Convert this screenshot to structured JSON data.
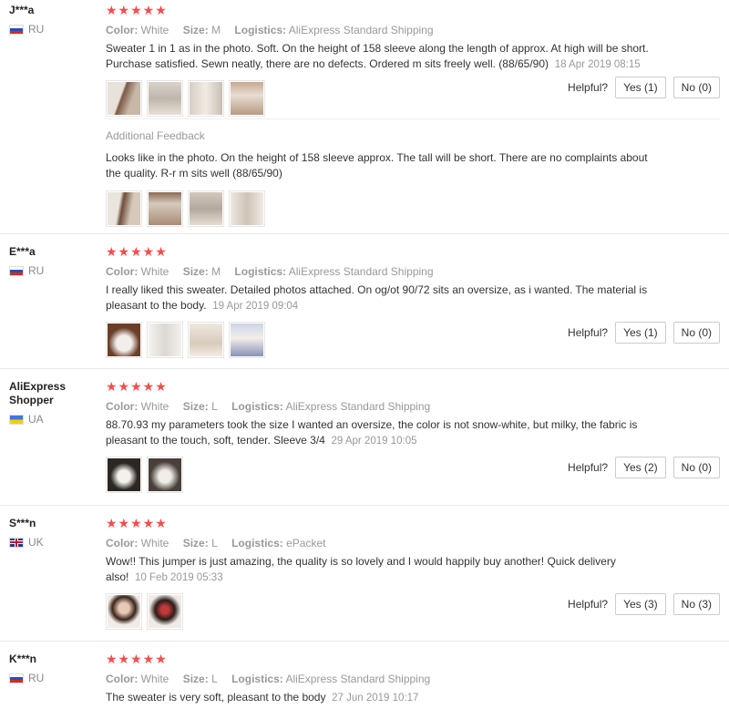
{
  "labels": {
    "color": "Color:",
    "size": "Size:",
    "logistics": "Logistics:",
    "helpful": "Helpful?"
  },
  "stars": "★★★★★",
  "colors": {
    "star": "#f44d4d",
    "meta": "#999999"
  },
  "reviews": [
    {
      "user": "J***a",
      "country": "RU",
      "flag": "ru",
      "color": "White",
      "size": "M",
      "logistics": "AliExpress Standard Shipping",
      "text": "Sweater 1 in 1 as in the photo. Soft. On the height of 158 sleeve along the length of approx. At high will be short. Purchase satisfied. Sewn neatly, there are no defects. Ordered m sits freely well. (88/65/90)",
      "date": "18 Apr 2019 08:15",
      "yes": "Yes (1)",
      "no": "No (0)",
      "additional_title": "Additional Feedback",
      "additional_text": "Looks like in the photo. On the height of 158 sleeve approx. The tall will be short. There are no complaints about the quality. R-r m sits well (88/65/90)"
    },
    {
      "user": "E***a",
      "country": "RU",
      "flag": "ru",
      "color": "White",
      "size": "M",
      "logistics": "AliExpress Standard Shipping",
      "text": "I really liked this sweater. Detailed photos attached. On og/ot 90/72 sits an oversize, as i wanted. The material is pleasant to the body.",
      "date": "19 Apr 2019 09:04",
      "yes": "Yes (1)",
      "no": "No (0)"
    },
    {
      "user": "AliExpress Shopper",
      "country": "UA",
      "flag": "ua",
      "color": "White",
      "size": "L",
      "logistics": "AliExpress Standard Shipping",
      "text": "88.70.93 my parameters took the size I wanted an oversize, the color is not snow-white, but milky, the fabric is pleasant to the touch, soft, tender. Sleeve 3/4",
      "date": "29 Apr 2019 10:05",
      "yes": "Yes (2)",
      "no": "No (0)"
    },
    {
      "user": "S***n",
      "country": "UK",
      "flag": "uk",
      "color": "White",
      "size": "L",
      "logistics": "ePacket",
      "text": "Wow!! This jumper is just amazing, the quality is so lovely and I would happily buy another! Quick delivery also!",
      "date": "10 Feb 2019 05:33",
      "yes": "Yes (3)",
      "no": "No (3)"
    },
    {
      "user": "K***n",
      "country": "RU",
      "flag": "ru",
      "color": "White",
      "size": "L",
      "logistics": "AliExpress Standard Shipping",
      "text": "The sweater is very soft, pleasant to the body",
      "date": "27 Jun 2019 10:17"
    }
  ]
}
